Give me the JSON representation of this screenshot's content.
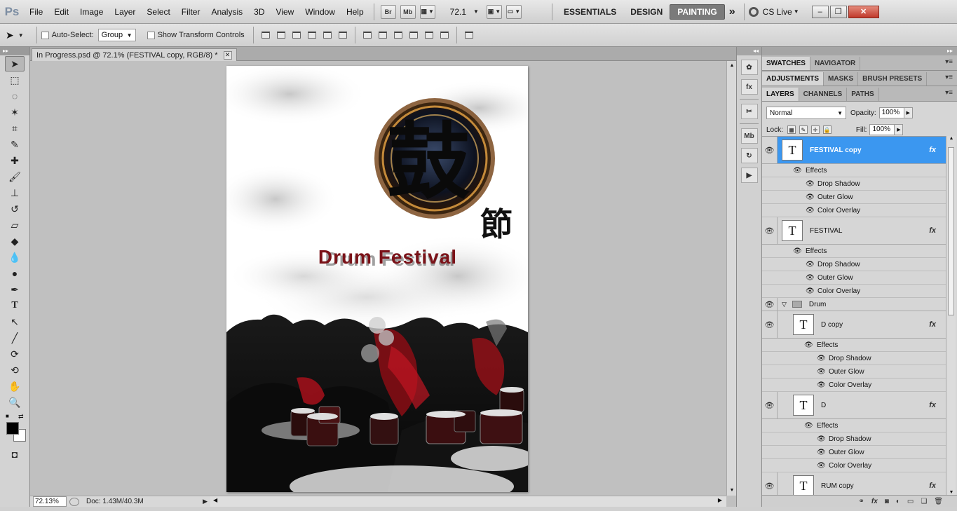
{
  "app": {
    "logo": "Ps"
  },
  "menu": [
    "File",
    "Edit",
    "Image",
    "Layer",
    "Select",
    "Filter",
    "Analysis",
    "3D",
    "View",
    "Window",
    "Help"
  ],
  "menubar": {
    "bridge_btn": "Br",
    "minibridge_btn": "Mb",
    "zoom_value": "72.1",
    "workspaces": [
      "ESSENTIALS",
      "DESIGN",
      "PAINTING"
    ],
    "active_workspace": "PAINTING",
    "more": "»",
    "cs_live": "CS Live"
  },
  "options": {
    "auto_select_label": "Auto-Select:",
    "auto_select_value": "Group",
    "transform_label": "Show Transform Controls"
  },
  "document_tab": {
    "title": "In Progress.psd @ 72.1% (FESTIVAL copy, RGB/8) *"
  },
  "status": {
    "zoom": "72.13%",
    "doc_info": "Doc: 1.43M/40.3M"
  },
  "artwork": {
    "festival_text": "Drum Festival",
    "glyph_main": "鼓",
    "glyph_sub": "節"
  },
  "panels": {
    "row1": [
      "SWATCHES",
      "NAVIGATOR"
    ],
    "row2": [
      "ADJUSTMENTS",
      "MASKS",
      "BRUSH PRESETS"
    ],
    "row3": [
      "LAYERS",
      "CHANNELS",
      "PATHS"
    ]
  },
  "layers_panel": {
    "blend_mode": "Normal",
    "opacity_label": "Opacity:",
    "opacity_value": "100%",
    "lock_label": "Lock:",
    "fill_label": "Fill:",
    "fill_value": "100%"
  },
  "layers": [
    {
      "name": "FESTIVAL copy",
      "selected": true,
      "effects_label": "Effects",
      "effects": [
        "Drop Shadow",
        "Outer Glow",
        "Color Overlay"
      ]
    },
    {
      "name": "FESTIVAL",
      "selected": false,
      "effects_label": "Effects",
      "effects": [
        "Drop Shadow",
        "Outer Glow",
        "Color Overlay"
      ]
    },
    {
      "group": "Drum"
    },
    {
      "name": "D copy",
      "indent": true,
      "effects_label": "Effects",
      "effects": [
        "Drop Shadow",
        "Outer Glow",
        "Color Overlay"
      ]
    },
    {
      "name": "D",
      "indent": true,
      "effects_label": "Effects",
      "effects": [
        "Drop Shadow",
        "Outer Glow",
        "Color Overlay"
      ]
    },
    {
      "name": "RUM copy",
      "indent": true
    }
  ],
  "colors": {
    "selection": "#3b97f0",
    "festival_red": "#7a1218",
    "painting_active": "#7a7a7a"
  }
}
